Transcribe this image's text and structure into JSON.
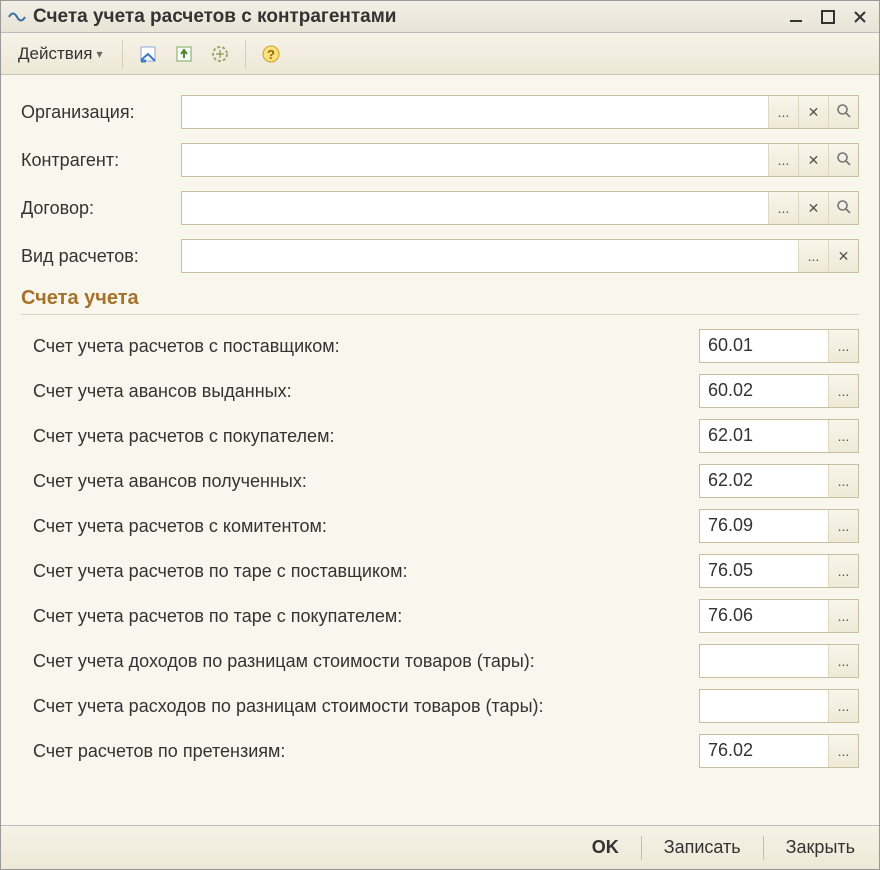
{
  "window": {
    "title": "Счета учета расчетов с контрагентами"
  },
  "toolbar": {
    "actions_label": "Действия"
  },
  "form": {
    "organization": {
      "label": "Организация:",
      "value": ""
    },
    "contractor": {
      "label": "Контрагент:",
      "value": ""
    },
    "contract": {
      "label": "Договор:",
      "value": ""
    },
    "settlements": {
      "label": "Вид расчетов:",
      "value": ""
    }
  },
  "section_title": "Счета учета",
  "accounts": [
    {
      "label": "Счет учета расчетов с поставщиком:",
      "value": "60.01"
    },
    {
      "label": "Счет учета авансов выданных:",
      "value": "60.02"
    },
    {
      "label": "Счет учета расчетов с покупателем:",
      "value": "62.01"
    },
    {
      "label": "Счет учета авансов полученных:",
      "value": "62.02"
    },
    {
      "label": "Счет учета расчетов с комитентом:",
      "value": "76.09"
    },
    {
      "label": "Счет учета расчетов по таре с поставщиком:",
      "value": "76.05"
    },
    {
      "label": "Счет учета расчетов по таре с покупателем:",
      "value": "76.06"
    },
    {
      "label": "Счет учета доходов по разницам стоимости товаров (тары):",
      "value": ""
    },
    {
      "label": "Счет учета расходов по разницам стоимости товаров (тары):",
      "value": ""
    },
    {
      "label": "Счет расчетов по претензиям:",
      "value": "76.02"
    }
  ],
  "buttons": {
    "ok": "OK",
    "write": "Записать",
    "close": "Закрыть"
  },
  "glyphs": {
    "ellipsis": "...",
    "clear": "✕",
    "search": "🔍",
    "dropdown": "▾"
  }
}
